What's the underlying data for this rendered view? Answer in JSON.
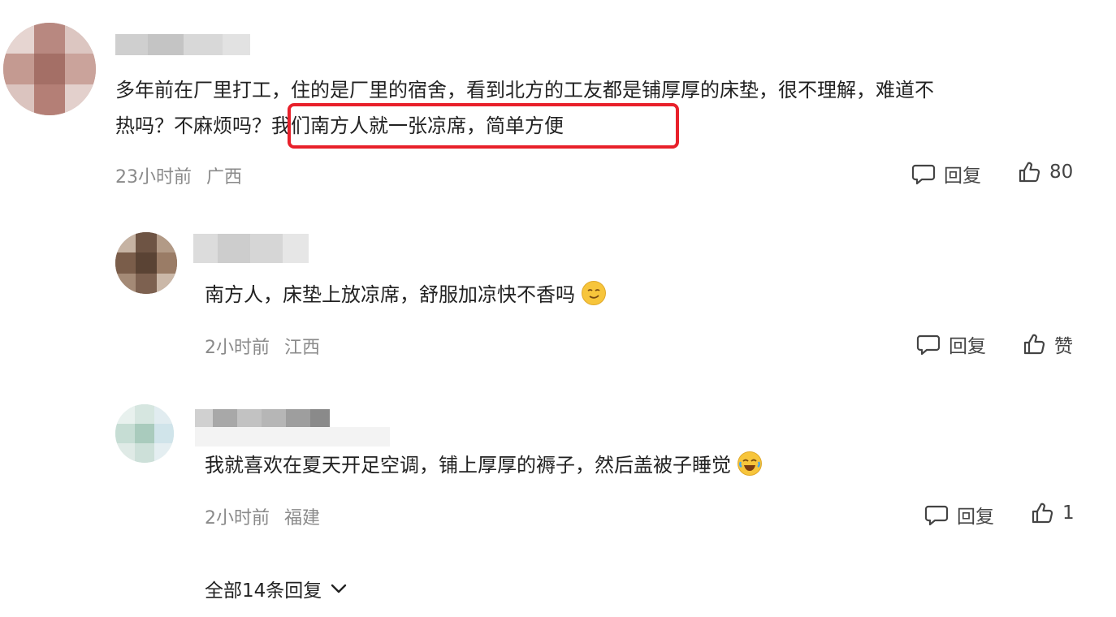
{
  "comments": [
    {
      "text_line1": "多年前在厂里打工，住的是厂里的宿舍，看到北方的工友都是铺厚厚的床垫，很不理解，难道不",
      "text_line2_a": "热吗？不麻烦吗？",
      "text_line2_b": "我们南方人就一张凉席，简单方便",
      "time": "23小时前",
      "location": "广西",
      "reply_label": "回复",
      "like_label": "80"
    },
    {
      "text": "南方人，床垫上放凉席，舒服加凉快不香吗",
      "emoji": "smirk-emoji",
      "time": "2小时前",
      "location": "江西",
      "reply_label": "回复",
      "like_label": "赞"
    },
    {
      "text": "我就喜欢在夏天开足空调，铺上厚厚的褥子，然后盖被子睡觉",
      "emoji": "tears-of-joy-emoji",
      "time": "2小时前",
      "location": "福建",
      "reply_label": "回复",
      "like_label": "1"
    }
  ],
  "more_replies": {
    "label": "全部14条回复"
  },
  "colors": {
    "highlight_border": "#e8202a",
    "meta_text": "#8a8a8a",
    "body_text": "#222222"
  }
}
